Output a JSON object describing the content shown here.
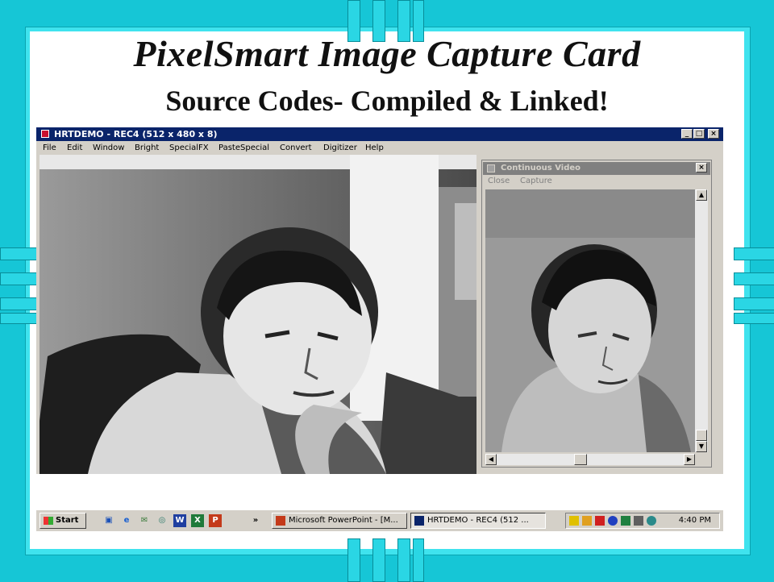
{
  "slide": {
    "title": "PixelSmart Image Capture Card",
    "subtitle": "Source Codes- Compiled & Linked!"
  },
  "main_window": {
    "title": "HRTDEMO - REC4 (512 x 480 x 8)",
    "controls": {
      "minimize": "_",
      "maximize": "□",
      "close": "×"
    },
    "menu": [
      "File",
      "Edit",
      "Window",
      "Bright",
      "SpecialFX",
      "PasteSpecial",
      "Convert",
      "Digitizer",
      "Help"
    ]
  },
  "video_window": {
    "title": "Continuous Video",
    "close_glyph": "×",
    "menu": [
      "Close",
      "Capture"
    ]
  },
  "taskbar": {
    "start_label": "Start",
    "more_glyph": "»",
    "tasks": [
      {
        "label": "Microsoft PowerPoint - [M...",
        "icon": "powerpoint-icon"
      },
      {
        "label": "HRTDEMO - REC4 (512 ...",
        "icon": "app-icon"
      }
    ],
    "clock": "4:40 PM"
  },
  "colors": {
    "background": "#16c6d6",
    "title_bar_active": "#0a246a",
    "title_bar_inactive": "#808080",
    "window_face": "#d4d0c8"
  }
}
